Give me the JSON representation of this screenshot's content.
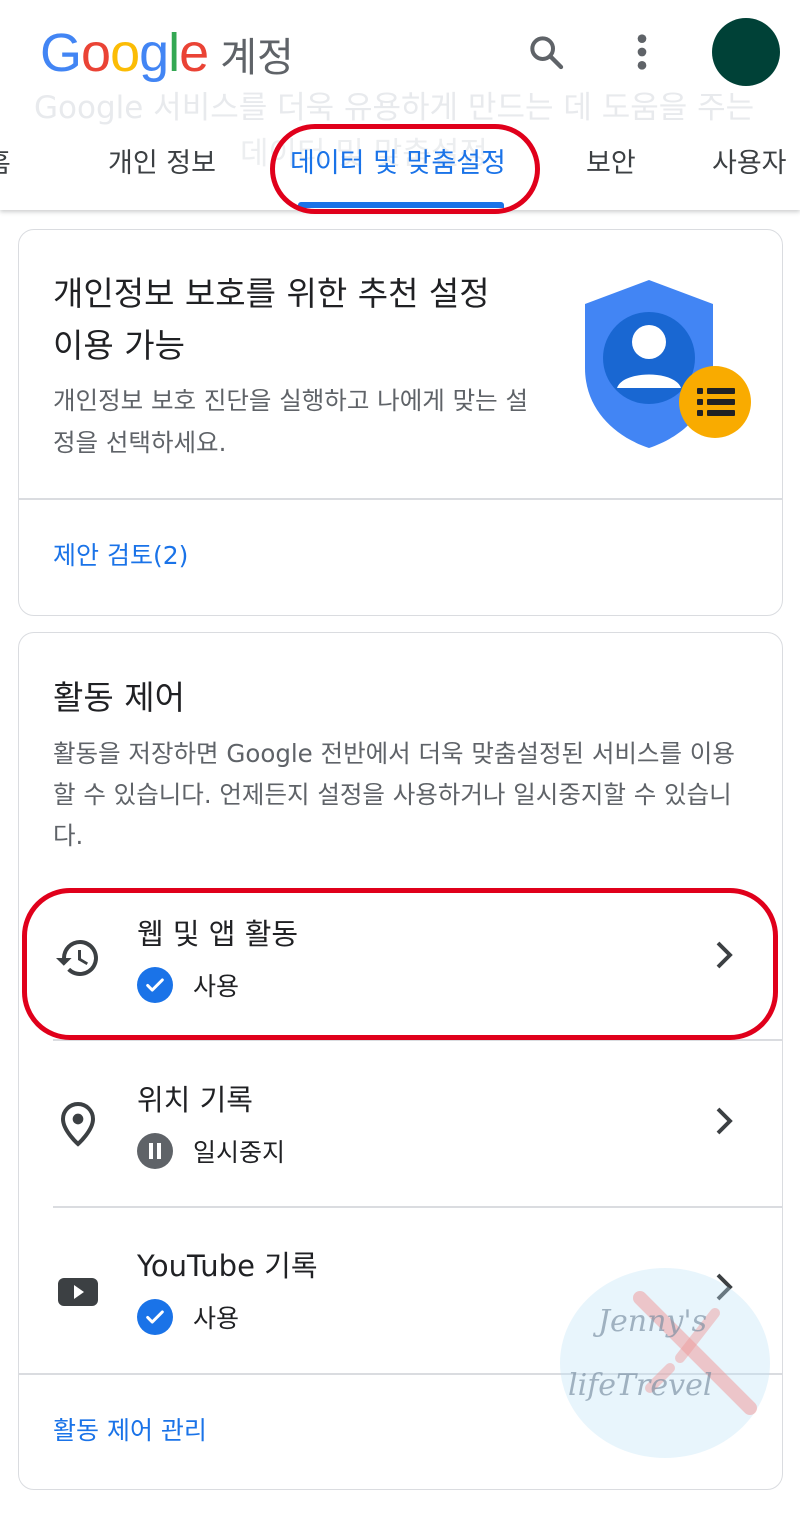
{
  "header": {
    "logo_letters": [
      {
        "char": "G",
        "color": "#4285F4"
      },
      {
        "char": "o",
        "color": "#EA4335"
      },
      {
        "char": "o",
        "color": "#FBBC05"
      },
      {
        "char": "g",
        "color": "#4285F4"
      },
      {
        "char": "l",
        "color": "#34A853"
      },
      {
        "char": "e",
        "color": "#EA4335"
      }
    ],
    "product": "계정",
    "faded_subtitle_line1": "Google 서비스를 더욱 유용하게 만드는 데 도움을 주는",
    "faded_subtitle_line2": "데이터 및 맞춤설정",
    "avatar_color": "#004137"
  },
  "tabs": [
    {
      "label": "홈"
    },
    {
      "label": "개인 정보"
    },
    {
      "label": "데이터 및 맞춤설정",
      "active": true
    },
    {
      "label": "보안"
    },
    {
      "label": "사용자"
    }
  ],
  "privacy_card": {
    "title": "개인정보 보호를 위한 추천 설정 이용 가능",
    "description": "개인정보 보호 진단을 실행하고 나에게 맞는 설정을 선택하세요.",
    "link": "제안 검토(2)",
    "icon": "shield-person-icon"
  },
  "activity_card": {
    "title": "활동 제어",
    "description": "활동을 저장하면 Google 전반에서 더욱 맞춤설정된 서비스를 이용할 수 있습니다. 언제든지 설정을 사용하거나 일시중지할 수 있습니다.",
    "items": [
      {
        "title": "웹 및 앱 활동",
        "status": "사용",
        "icon": "history-icon",
        "status_icon": "check-circle-icon"
      },
      {
        "title": "위치 기록",
        "status": "일시중지",
        "icon": "location-pin-icon",
        "status_icon": "pause-circle-icon"
      },
      {
        "title": "YouTube 기록",
        "status": "사용",
        "icon": "youtube-icon",
        "status_icon": "check-circle-icon"
      }
    ],
    "manage_link": "활동 제어 관리"
  },
  "watermark": {
    "line1": "Jenny's",
    "line2": "lifeTrevel"
  },
  "colors": {
    "accent": "#1a73e8",
    "highlight": "#e0001b",
    "status_on": "#1a73e8",
    "status_paused": "#5f6368"
  }
}
